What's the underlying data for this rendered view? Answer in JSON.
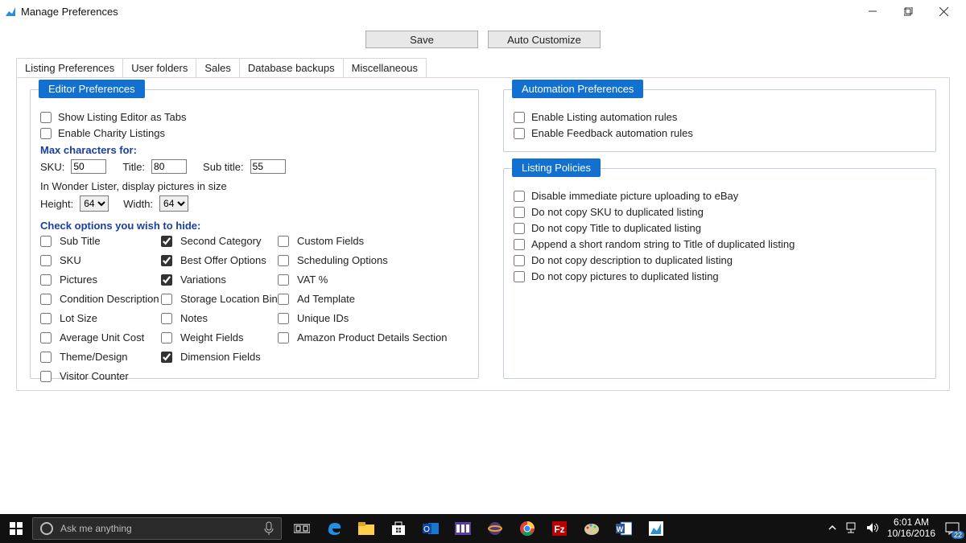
{
  "window": {
    "title": "Manage Preferences"
  },
  "topbar": {
    "save": "Save",
    "auto_customize": "Auto Customize"
  },
  "tabs": {
    "listing_preferences": "Listing Preferences",
    "user_folders": "User folders",
    "sales": "Sales",
    "database_backups": "Database backups",
    "miscellaneous": "Miscellaneous"
  },
  "editor": {
    "legend": "Editor Preferences",
    "show_tabs": "Show Listing Editor as Tabs",
    "enable_charity": "Enable Charity Listings",
    "max_chars_label": "Max characters for:",
    "sku_label": "SKU:",
    "sku_value": "50",
    "title_label": "Title:",
    "title_value": "80",
    "subtitle_label": "Sub title:",
    "subtitle_value": "55",
    "picture_size_label": "In Wonder Lister, display pictures in size",
    "height_label": "Height:",
    "height_value": "64",
    "width_label": "Width:",
    "width_value": "64",
    "hide_label": "Check options you wish to hide:",
    "col1": {
      "sub_title": "Sub Title",
      "sku": "SKU",
      "pictures": "Pictures",
      "condition_desc": "Condition Description",
      "lot_size": "Lot Size",
      "avg_unit_cost": "Average Unit Cost",
      "theme_design": "Theme/Design",
      "visitor_counter": "Visitor Counter"
    },
    "col2": {
      "second_category": "Second Category",
      "best_offer": "Best Offer Options",
      "variations": "Variations",
      "storage_bin": "Storage Location Bin",
      "notes": "Notes",
      "weight_fields": "Weight Fields",
      "dimension_fields": "Dimension Fields"
    },
    "col3": {
      "custom_fields": "Custom Fields",
      "scheduling": "Scheduling Options",
      "vat": "VAT %",
      "ad_template": "Ad Template",
      "unique_ids": "Unique IDs",
      "amazon": "Amazon Product Details Section"
    }
  },
  "automation": {
    "legend": "Automation Preferences",
    "listing_rules": "Enable Listing automation rules",
    "feedback_rules": "Enable Feedback automation rules"
  },
  "policies": {
    "legend": "Listing Policies",
    "disable_upload": "Disable immediate picture uploading to eBay",
    "no_copy_sku": "Do not copy SKU to duplicated listing",
    "no_copy_title": "Do not copy Title to duplicated listing",
    "append_random": "Append a short random string to Title of duplicated listing",
    "no_copy_desc": "Do not copy description to duplicated listing",
    "no_copy_pics": "Do not copy pictures to duplicated listing"
  },
  "taskbar": {
    "search_placeholder": "Ask me anything",
    "time": "6:01 AM",
    "date": "10/16/2016",
    "notif_count": "22"
  }
}
